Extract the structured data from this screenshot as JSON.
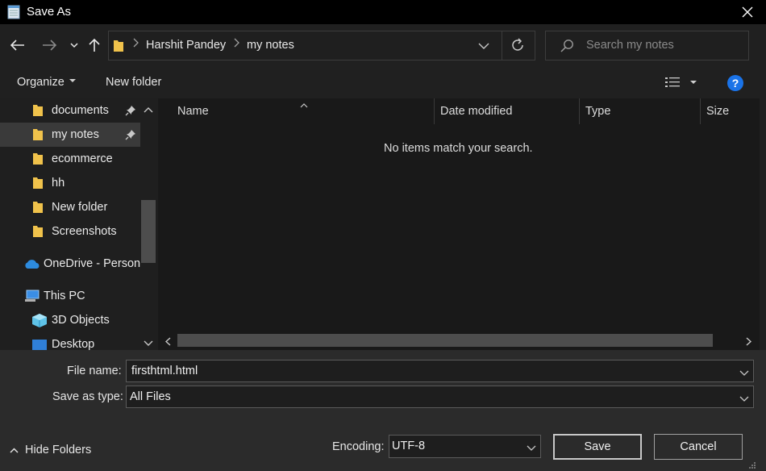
{
  "window": {
    "title": "Save As"
  },
  "address": {
    "crumbs": [
      "Harshit Pandey",
      "my notes"
    ]
  },
  "search": {
    "placeholder": "Search my notes"
  },
  "toolbar": {
    "organize_label": "Organize",
    "new_folder_label": "New folder",
    "help_label": "?"
  },
  "sidebar": {
    "items": [
      {
        "label": "documents",
        "icon": "folder-icon",
        "pinned": true,
        "selected": false
      },
      {
        "label": "my notes",
        "icon": "folder-icon",
        "pinned": true,
        "selected": true
      },
      {
        "label": "ecommerce",
        "icon": "folder-icon",
        "pinned": false,
        "selected": false
      },
      {
        "label": "hh",
        "icon": "folder-icon",
        "pinned": false,
        "selected": false
      },
      {
        "label": "New folder",
        "icon": "folder-icon",
        "pinned": false,
        "selected": false
      },
      {
        "label": "Screenshots",
        "icon": "folder-icon",
        "pinned": false,
        "selected": false
      },
      {
        "label": "OneDrive - Person",
        "icon": "onedrive-icon",
        "pinned": false,
        "selected": false
      },
      {
        "label": "This PC",
        "icon": "pc-icon",
        "pinned": false,
        "selected": false
      },
      {
        "label": "3D Objects",
        "icon": "3d-objects-icon",
        "pinned": false,
        "selected": false
      },
      {
        "label": "Desktop",
        "icon": "desktop-icon",
        "pinned": false,
        "selected": false
      }
    ]
  },
  "columns": [
    "Name",
    "Date modified",
    "Type",
    "Size"
  ],
  "main": {
    "empty_message": "No items match your search."
  },
  "form": {
    "file_name_label": "File name:",
    "file_name_value": "firsthtml.html",
    "save_type_label": "Save as type:",
    "save_type_value": "All Files",
    "encoding_label": "Encoding:",
    "encoding_value": "UTF-8"
  },
  "footer": {
    "hide_folders_label": "Hide Folders",
    "save_label": "Save",
    "cancel_label": "Cancel"
  },
  "colors": {
    "folder": "#f0c24b",
    "accent": "#1a73e8",
    "onedrive": "#2d8bde"
  }
}
